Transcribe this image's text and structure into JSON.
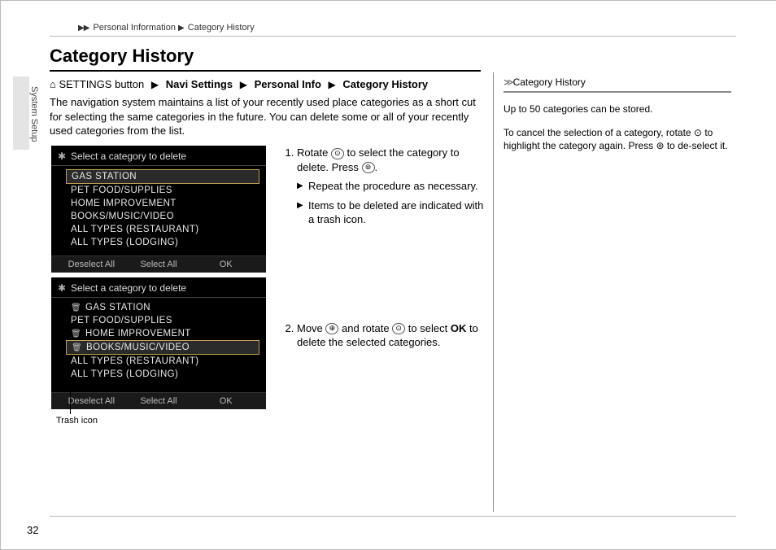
{
  "breadcrumb": {
    "parent": "Personal Information",
    "current": "Category History"
  },
  "sideTab": "System Setup",
  "title": "Category History",
  "navpath": {
    "prefix": "SETTINGS button",
    "items": [
      "Navi Settings",
      "Personal Info",
      "Category History"
    ]
  },
  "intro": "The navigation system maintains a list of your recently used place categories as a short cut for selecting the same categories in the future. You can delete some or all of your recently used categories from the list.",
  "screenshot1": {
    "header": "Select a category to delete",
    "rows": [
      {
        "label": "GAS STATION",
        "selected": true,
        "trash": false
      },
      {
        "label": "PET FOOD/SUPPLIES",
        "selected": false,
        "trash": false
      },
      {
        "label": "HOME IMPROVEMENT",
        "selected": false,
        "trash": false
      },
      {
        "label": "BOOKS/MUSIC/VIDEO",
        "selected": false,
        "trash": false
      },
      {
        "label": "ALL TYPES (RESTAURANT)",
        "selected": false,
        "trash": false
      },
      {
        "label": "ALL TYPES (LODGING)",
        "selected": false,
        "trash": false
      }
    ],
    "footer": {
      "left": "Deselect All",
      "center": "Select All",
      "right": "OK"
    }
  },
  "screenshot2": {
    "header": "Select a category to delete",
    "rows": [
      {
        "label": "GAS STATION",
        "selected": false,
        "trash": true
      },
      {
        "label": "PET FOOD/SUPPLIES",
        "selected": false,
        "trash": false
      },
      {
        "label": "HOME IMPROVEMENT",
        "selected": false,
        "trash": true
      },
      {
        "label": "BOOKS/MUSIC/VIDEO",
        "selected": true,
        "trash": true
      },
      {
        "label": "ALL TYPES (RESTAURANT)",
        "selected": false,
        "trash": false
      },
      {
        "label": "ALL TYPES (LODGING)",
        "selected": false,
        "trash": false
      }
    ],
    "footer": {
      "left": "Deselect All",
      "center": "Select All",
      "right": "OK"
    }
  },
  "calloutLabel": "Trash icon",
  "steps": {
    "s1_a": "Rotate ",
    "s1_b": " to select the category to delete. Press ",
    "s1_c": ".",
    "s1_sub1": "Repeat the procedure as necessary.",
    "s1_sub2": "Items to be deleted are indicated with a trash icon.",
    "s2_a": "Move ",
    "s2_b": " and rotate ",
    "s2_c": " to select ",
    "s2_ok": "OK",
    "s2_d": " to delete the selected categories."
  },
  "sidebar": {
    "heading": "Category History",
    "p1": "Up to 50 categories can be stored.",
    "p2_a": "To cancel the selection of a category, rotate ",
    "p2_b": " to highlight the category again. Press ",
    "p2_c": " to de-select it."
  },
  "pageNumber": "32"
}
